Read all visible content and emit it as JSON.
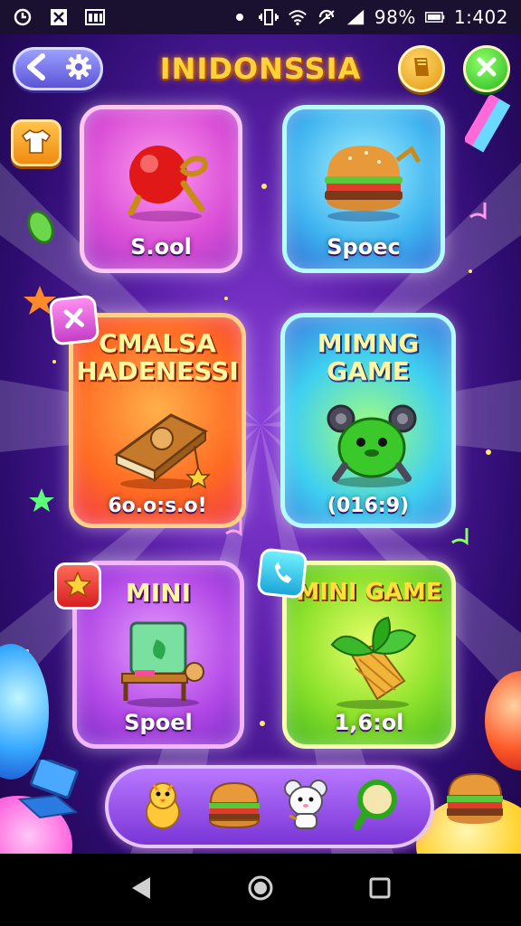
{
  "status_bar": {
    "battery": "98%",
    "time": "1:402"
  },
  "header": {
    "title": "INIDONSSIA"
  },
  "cards": [
    {
      "label": "S.ool",
      "icon": "red-ball-icon"
    },
    {
      "label": "Spoec",
      "icon": "burger-icon"
    },
    {
      "title": "CMALSA\nHADENESSI",
      "label": "6o.o:s.o!",
      "icon": "book-icon"
    },
    {
      "title": "MIMNG\nGAME",
      "label": "(016:9)",
      "icon": "green-critter-icon"
    },
    {
      "title": "MINI",
      "label": "Spoel",
      "icon": "tablet-icon"
    },
    {
      "title": "MINI GAME",
      "label": "1,6:ol",
      "icon": "leaf-icon"
    }
  ],
  "tray_items": [
    "chick-icon",
    "burger-icon",
    "mouse-icon",
    "magnifier-icon"
  ],
  "colors": {
    "title": "#ffd23a",
    "background": "#5a1fa8"
  }
}
